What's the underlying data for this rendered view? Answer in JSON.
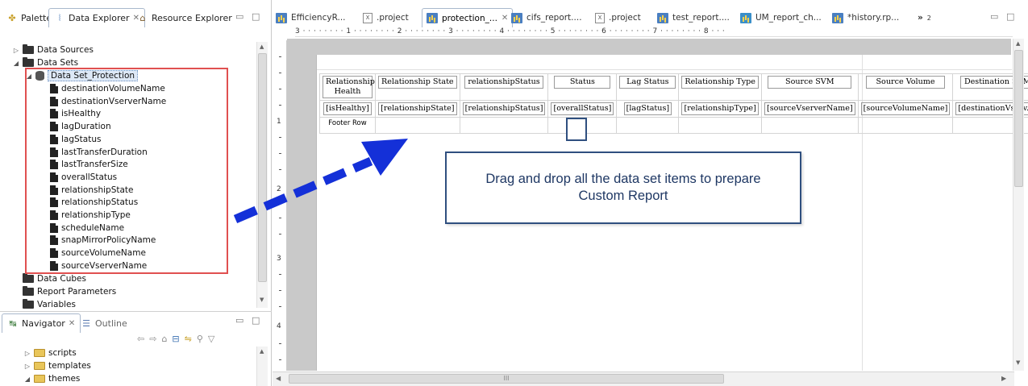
{
  "left_views": {
    "tabs": [
      {
        "label": "Palette",
        "icon": "palette-icon"
      },
      {
        "label": "Data Explorer",
        "icon": "data-explorer-icon",
        "active": true
      },
      {
        "label": "Resource Explorer",
        "icon": "resource-explorer-icon"
      }
    ]
  },
  "data_explorer": {
    "items": {
      "data_sources": "Data Sources",
      "data_sets": "Data Sets",
      "data_set_name": "Data Set_Protection",
      "fields": [
        "destinationVolumeName",
        "destinationVserverName",
        "isHealthy",
        "lagDuration",
        "lagStatus",
        "lastTransferDuration",
        "lastTransferSize",
        "overallStatus",
        "relationshipState",
        "relationshipStatus",
        "relationshipType",
        "scheduleName",
        "snapMirrorPolicyName",
        "sourceVolumeName",
        "sourceVserverName"
      ],
      "data_cubes": "Data Cubes",
      "report_parameters": "Report Parameters",
      "variables": "Variables"
    }
  },
  "navigator": {
    "tabs": [
      {
        "label": "Navigator",
        "active": true
      },
      {
        "label": "Outline"
      }
    ],
    "items": [
      "scripts",
      "templates",
      "themes"
    ]
  },
  "editor_tabs": [
    {
      "label": "EfficiencyR...",
      "icon": "report-icon"
    },
    {
      "label": ".project",
      "icon": "xml-file-icon"
    },
    {
      "label": "protection_...",
      "icon": "report-icon",
      "active": true
    },
    {
      "label": "cifs_report....",
      "icon": "report-icon"
    },
    {
      "label": ".project",
      "icon": "xml-file-icon"
    },
    {
      "label": "test_report....",
      "icon": "report-icon"
    },
    {
      "label": "UM_report_ch...",
      "icon": "report-icon"
    },
    {
      "label": "*history.rp...",
      "icon": "report-icon"
    }
  ],
  "overflow_tabs": "»",
  "overflow_count": "2",
  "ruler_text": "3 · · · · · · · · 1 · · · · · · · · 2 · · · · · · · · 3 · · · · · · · · 4 · · · · · · · · 5 · · · · · · · · 6 · · · · · · · · 7 · · · · · · · · 8 · · ·",
  "vertical_ruler_numbers": [
    "1",
    "2",
    "3",
    "4"
  ],
  "report_table": {
    "headers": [
      "Relationship Health",
      "Relationship State",
      "relationshipStatus",
      "Status",
      "Lag Status",
      "Relationship Type",
      "Source SVM",
      "Source Volume",
      "Destination SVM",
      "D"
    ],
    "row": [
      "[isHealthy]",
      "[relationshipState]",
      "[relationshipStatus]",
      "[overallStatus]",
      "[lagStatus]",
      "[relationshipType]",
      "[sourceVserverName]",
      "[sourceVolumeName]",
      "[destinationVserv...]",
      "[d"
    ],
    "footer_label": "Footer Row"
  },
  "callout": {
    "line1": "Drag and drop all the data set items to prepare",
    "line2": "Custom Report"
  },
  "colors": {
    "callout_border": "#2f4f7f",
    "arrow": "#1430d8",
    "highlight_box": "#e05050"
  },
  "hscroll_grip": "III"
}
